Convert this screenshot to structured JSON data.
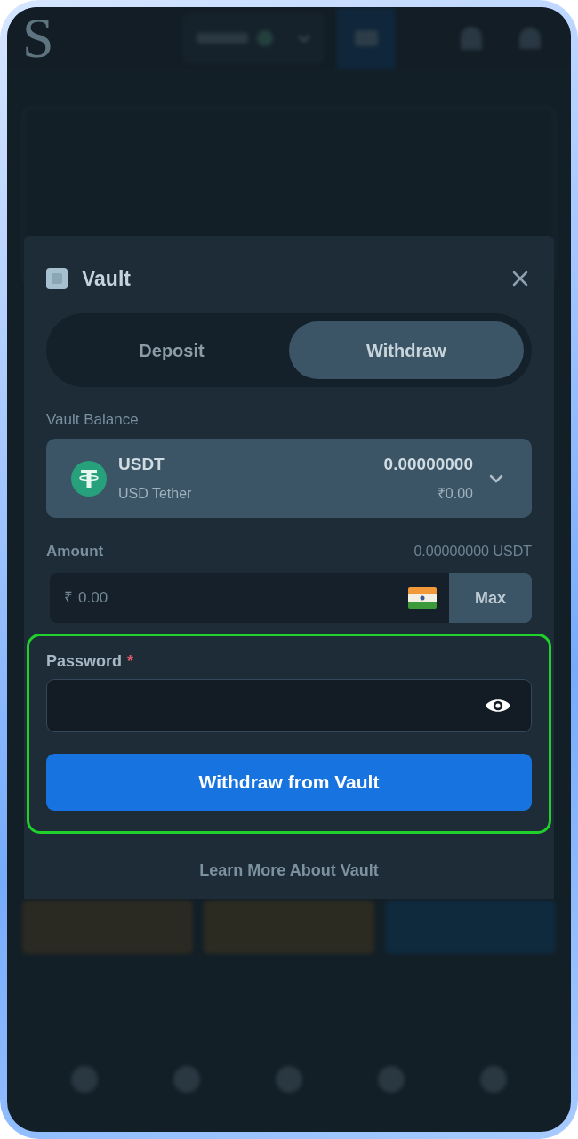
{
  "header": {
    "logo": "S"
  },
  "vault_modal": {
    "title": "Vault",
    "tabs": [
      {
        "label": "Deposit",
        "selected": false
      },
      {
        "label": "Withdraw",
        "selected": true
      }
    ],
    "balance_label": "Vault Balance",
    "currency": {
      "symbol": "USDT",
      "name": "USD Tether",
      "amount": "0.00000000",
      "fiat": "₹0.00"
    },
    "amount": {
      "label": "Amount",
      "available": "0.00000000 USDT",
      "prefix": "₹",
      "placeholder": "0.00",
      "max_button": "Max"
    },
    "password": {
      "label": "Password",
      "required_mark": "*"
    },
    "submit_button": "Withdraw from Vault",
    "learn_more_link": "Learn More About Vault"
  }
}
